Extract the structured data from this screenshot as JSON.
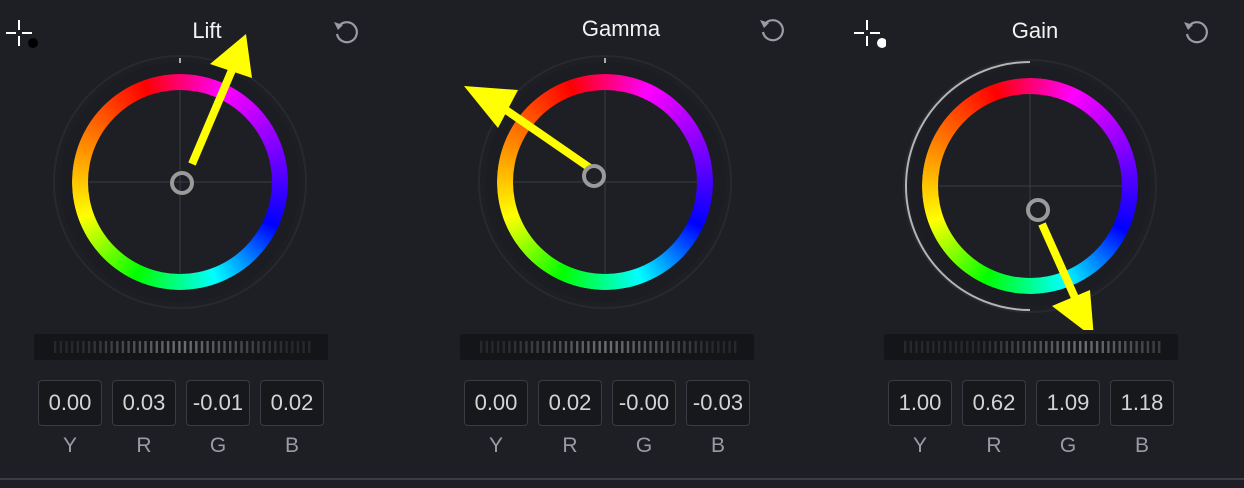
{
  "panels": [
    {
      "id": "lift",
      "title": "Lift",
      "picker_icon": "color-picker-crosshair-icon",
      "picker_dot": "black",
      "reset_icon": "reset-icon",
      "has_gain_arc": false,
      "values": [
        {
          "label": "Y",
          "value": "0.00"
        },
        {
          "label": "R",
          "value": "0.03"
        },
        {
          "label": "G",
          "value": "-0.01"
        },
        {
          "label": "B",
          "value": "0.02"
        }
      ]
    },
    {
      "id": "gamma",
      "title": "Gamma",
      "picker_icon": "",
      "reset_icon": "reset-icon",
      "has_gain_arc": false,
      "values": [
        {
          "label": "Y",
          "value": "0.00"
        },
        {
          "label": "R",
          "value": "0.02"
        },
        {
          "label": "G",
          "value": "-0.00"
        },
        {
          "label": "B",
          "value": "-0.03"
        }
      ]
    },
    {
      "id": "gain",
      "title": "Gain",
      "picker_icon": "color-picker-crosshair-icon",
      "picker_dot": "white",
      "reset_icon": "reset-icon",
      "has_gain_arc": true,
      "values": [
        {
          "label": "Y",
          "value": "1.00"
        },
        {
          "label": "R",
          "value": "0.62"
        },
        {
          "label": "G",
          "value": "1.09"
        },
        {
          "label": "B",
          "value": "1.18"
        }
      ]
    }
  ],
  "colors": {
    "background": "#1e1f24",
    "arrow": "#ffff00",
    "ring_gradient": [
      "#ff0000",
      "#ff00ff",
      "#7f00ff",
      "#0000ff",
      "#00ffff",
      "#00ff00",
      "#ffff00",
      "#ff7f00",
      "#ff0000"
    ]
  }
}
